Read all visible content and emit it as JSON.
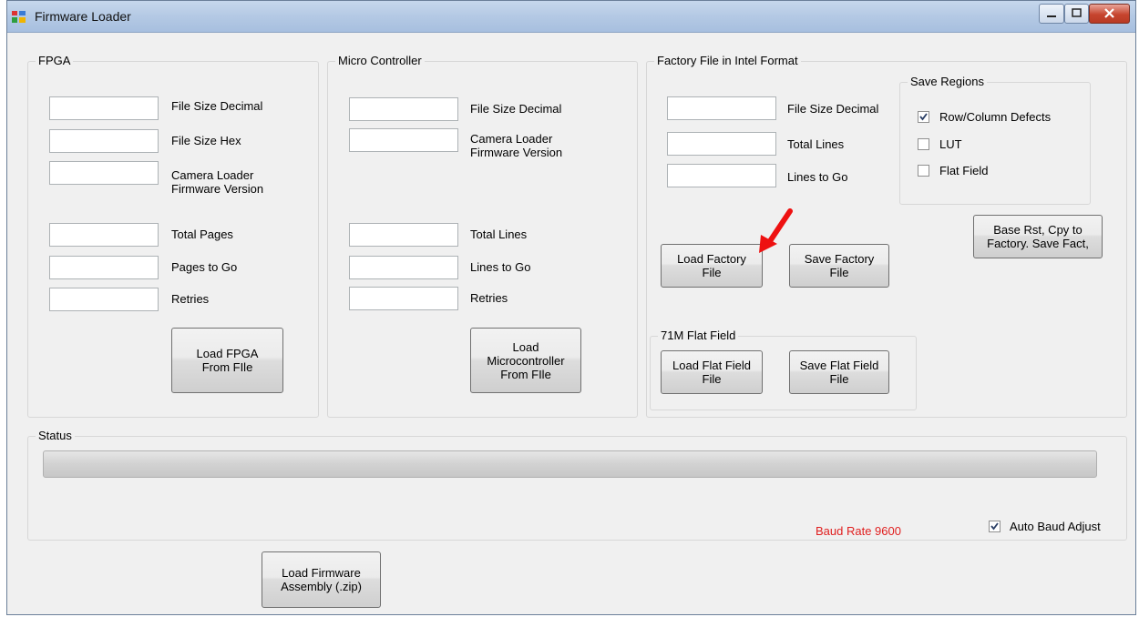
{
  "window": {
    "title": "Firmware Loader"
  },
  "fpga": {
    "legend": "FPGA",
    "fields": {
      "file_size_decimal": "File Size Decimal",
      "file_size_hex": "File Size Hex",
      "camera_loader_fw": "Camera Loader\nFirmware Version",
      "total_pages": "Total Pages",
      "pages_to_go": "Pages to Go",
      "retries": "Retries"
    },
    "load_button": "Load FPGA\nFrom FIle"
  },
  "micro": {
    "legend": "Micro Controller",
    "fields": {
      "file_size_decimal": "File Size Decimal",
      "camera_loader_fw": "Camera Loader\nFirmware Version",
      "total_lines": "Total Lines",
      "lines_to_go": "Lines to Go",
      "retries": "Retries"
    },
    "load_button": "Load\nMicrocontroller\nFrom FIle"
  },
  "factory": {
    "legend": "Factory File in Intel Format",
    "fields": {
      "file_size_decimal": "File Size Decimal",
      "total_lines": "Total Lines",
      "lines_to_go": "Lines to Go"
    },
    "load_button": "Load Factory\nFile",
    "save_button": "Save Factory\nFile",
    "base_button": "Base Rst, Cpy to\nFactory. Save Fact,"
  },
  "save_regions": {
    "legend": "Save Regions",
    "items": [
      {
        "label": "Row/Column Defects",
        "checked": true
      },
      {
        "label": "LUT",
        "checked": false
      },
      {
        "label": "Flat Field",
        "checked": false
      }
    ]
  },
  "flat_field": {
    "legend": "71M Flat Field",
    "load_button": "Load Flat Field\nFile",
    "save_button": "Save Flat Field\nFile"
  },
  "status": {
    "legend": "Status",
    "progress": 0,
    "baud_rate": "Baud Rate 9600",
    "baud_color": "#e02020",
    "auto_baud": {
      "label": "Auto Baud Adjust",
      "checked": true
    }
  },
  "footer": {
    "load_assembly_button": "Load Firmware\nAssembly (.zip)"
  },
  "annotation": {
    "arrow_color": "#ee1111"
  }
}
